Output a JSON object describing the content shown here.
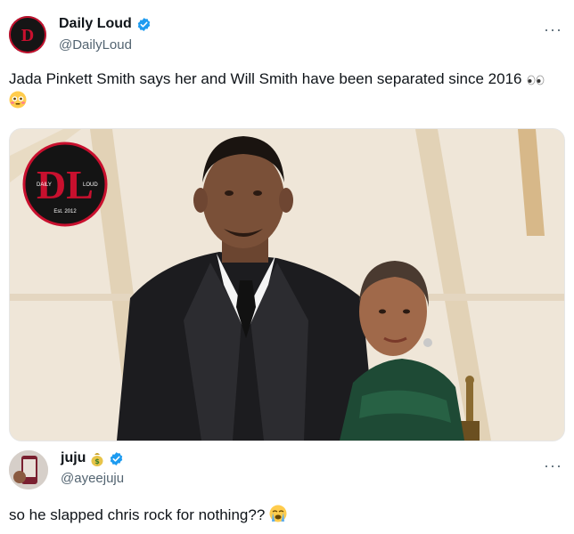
{
  "tweet1": {
    "name": "Daily Loud",
    "handle": "@DailyLoud",
    "text": "Jada Pinkett Smith says her and Will Smith have been separated since 2016",
    "logo": {
      "left_text": "DAILY",
      "right_text": "LOUD",
      "est_text": "Est. 2012",
      "monogram": "DL"
    }
  },
  "tweet2": {
    "name": "juju",
    "handle": "@ayeejuju",
    "text": "so he slapped chris rock for nothing??"
  },
  "icons": {
    "verified": "verified-badge-icon",
    "more": "more-options-icon",
    "eyes": "eyes-emoji-icon",
    "flushed": "flushed-face-emoji-icon",
    "money_bag": "money-bag-emoji-icon",
    "crying": "loudly-crying-face-emoji-icon"
  },
  "colors": {
    "verified_blue": "#1d9bf0",
    "text": "#0f1419",
    "muted": "#536471",
    "logo_red": "#c8102e"
  }
}
